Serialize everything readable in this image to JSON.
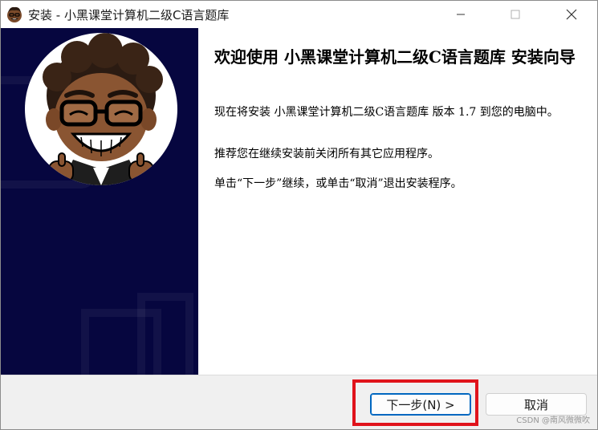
{
  "window": {
    "title": "安装 - 小黑课堂计算机二级C语言题库"
  },
  "content": {
    "heading": "欢迎使用 小黑课堂计算机二级C语言题库 安装向导",
    "paragraph_1": "现在将安装 小黑课堂计算机二级C语言题库 版本 1.7 到您的电脑中。",
    "paragraph_2": "推荐您在继续安装前关闭所有其它应用程序。",
    "paragraph_3": "单击“下一步”继续，或单击“取消”退出安装程序。"
  },
  "buttons": {
    "next": "下一步(N) >",
    "cancel": "取消"
  },
  "watermark": "CSDN @南风微微吹",
  "icons": {
    "app": "cartoon-avatar-icon",
    "minimize": "minimize-icon",
    "maximize": "maximize-icon",
    "close": "close-icon"
  },
  "colors": {
    "left_panel": "#06063f",
    "highlight_border": "#e0131b",
    "primary_button_border": "#0067c0"
  }
}
